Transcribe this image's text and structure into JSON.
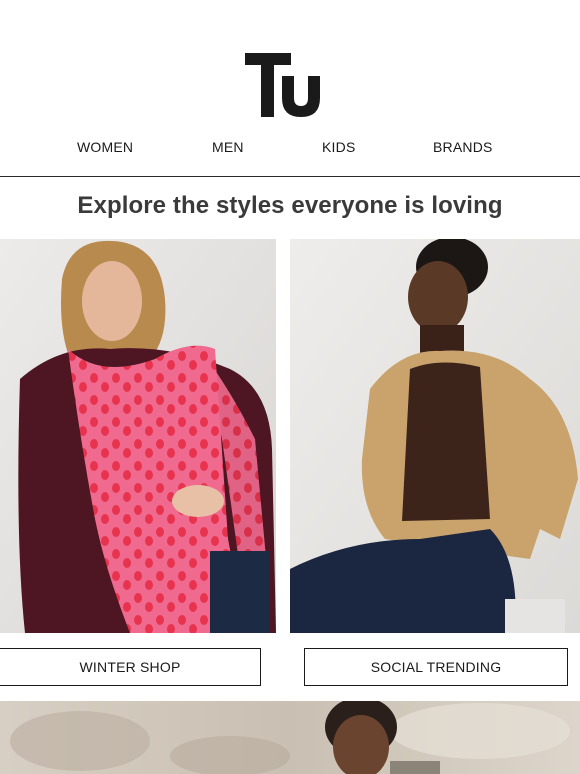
{
  "brand": {
    "logo_text": "Tu",
    "logo_color": "#1a1a1a"
  },
  "nav": {
    "items": [
      "WOMEN",
      "MEN",
      "KIDS",
      "BRANDS"
    ]
  },
  "headline": "Explore the styles everyone is loving",
  "tiles": [
    {
      "cta_label": "WINTER SHOP",
      "image": "woman-in-burgundy-jumper-and-pink-leopard-scarf"
    },
    {
      "cta_label": "SOCIAL TRENDING",
      "image": "woman-in-tan-jacket-and-dark-jeans-seated"
    }
  ],
  "banner": {
    "image": "woman-with-braided-hair-outdoors"
  },
  "colors": {
    "text": "#1a1a1a",
    "headline": "#3a3a3a",
    "divider": "#2b2b2b",
    "background": "#ffffff"
  }
}
